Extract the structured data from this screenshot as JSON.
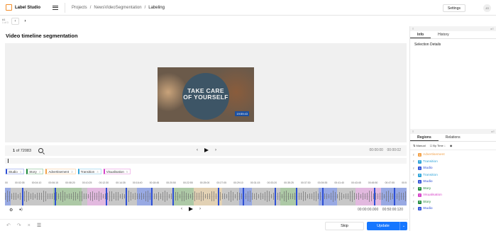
{
  "app": {
    "name": "Label Studio"
  },
  "breadcrumbs": [
    "Projects",
    "/",
    "NewsVideoSegmentation",
    "/",
    "Labeling"
  ],
  "topbar": {
    "settings_label": "Settings",
    "avatar_initials": "JO"
  },
  "task": {
    "id": "#1",
    "position": "1 of 3"
  },
  "page_title": "Video timeline segmentation",
  "video": {
    "overlay_text_1": "TAKE CARE",
    "overlay_text_2": "OF YOURSELF",
    "timestamp": "19:59:43"
  },
  "controls": {
    "frame_current": "1",
    "frame_of": "of 72083",
    "time_display_1": "00:00:00",
    "time_display_2": "00:00:02"
  },
  "labels": [
    {
      "name": "Studio",
      "key": "1",
      "color": "#2d4fd6"
    },
    {
      "name": "Story",
      "key": "2",
      "color": "#1e8a3a"
    },
    {
      "name": "Advertisement",
      "key": "3",
      "color": "#f2a24b"
    },
    {
      "name": "Transition",
      "key": "4",
      "color": "#2fa4d9"
    },
    {
      "name": "Visualisation",
      "key": "5",
      "color": "#d642c8"
    }
  ],
  "timeline": {
    "ticks": [
      "00",
      "00:02:05",
      "00:04:10",
      "00:06:15",
      "00:08:20",
      "00:10:25",
      "00:12:30",
      "00:14:35",
      "00:16:40",
      "00:18:45",
      "00:20:50",
      "00:22:55",
      "00:25:00",
      "00:27:05",
      "00:29:10",
      "00:31:15",
      "00:33:20",
      "00:35:25",
      "00:37:30",
      "00:39:35",
      "00:41:40",
      "00:43:45",
      "00:45:50",
      "00:47:55",
      "00:5"
    ],
    "time_left": "00:00:00.000",
    "time_right": "00:50:00:120"
  },
  "footer": {
    "skip_label": "Skip",
    "update_label": "Update"
  },
  "sidebar": {
    "tabs_top": [
      "Info",
      "History"
    ],
    "selection_details": "Selection Details",
    "tabs_bottom": [
      "Regions",
      "Relations"
    ],
    "toolbar": [
      "Manual",
      "By Time"
    ],
    "regions": [
      {
        "num": "1",
        "label": "Advertisement",
        "color": "#f2a24b"
      },
      {
        "num": "2",
        "label": "Transition",
        "color": "#2fa4d9"
      },
      {
        "num": "3",
        "label": "Studio",
        "color": "#2d4fd6"
      },
      {
        "num": "4",
        "label": "Transition",
        "color": "#2fa4d9"
      },
      {
        "num": "5",
        "label": "Studio",
        "color": "#2d4fd6"
      },
      {
        "num": "6",
        "label": "Story",
        "color": "#1e8a3a"
      },
      {
        "num": "7",
        "label": "Visualisation",
        "color": "#d642c8"
      },
      {
        "num": "8",
        "label": "Story",
        "color": "#1e8a3a"
      },
      {
        "num": "9",
        "label": "Studio",
        "color": "#2d4fd6"
      }
    ]
  }
}
